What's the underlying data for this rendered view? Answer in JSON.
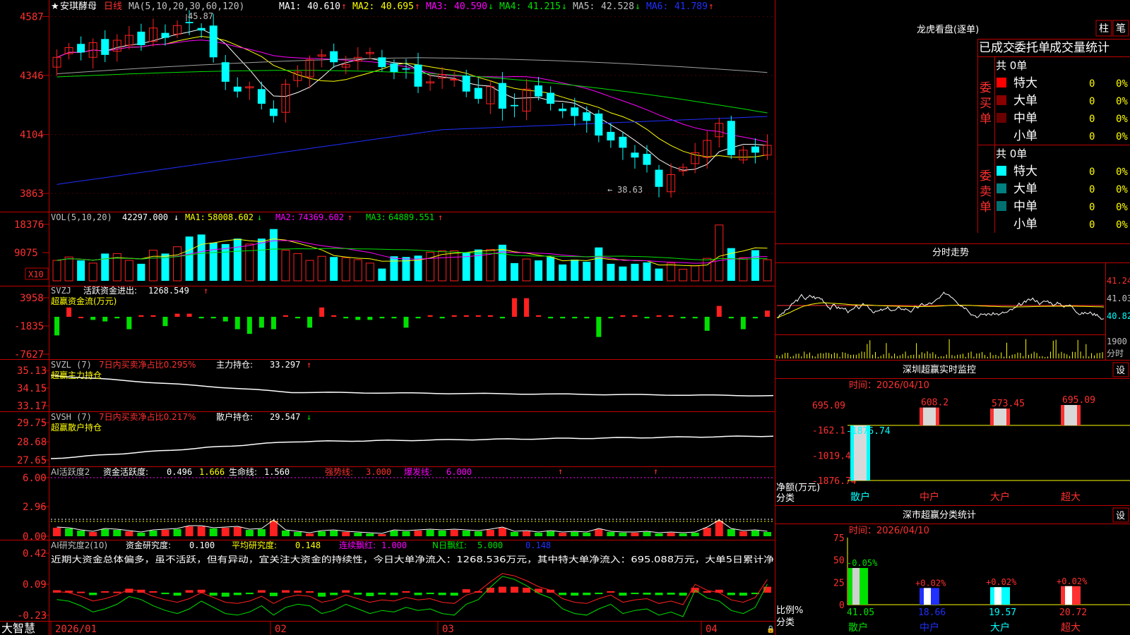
{
  "colors": {
    "up": "#ff2020",
    "down": "#00ffff",
    "grid": "#c00000",
    "text": "#c0c0c0",
    "yellow": "#ffff00",
    "magenta": "#ff00ff",
    "green": "#00e000",
    "white": "#ffffff",
    "blue": "#2030ff",
    "gray": "#a0a0a0"
  },
  "app": {
    "name": "大智慧",
    "lock_icon": "lock-icon"
  },
  "main_panel": {
    "title_star": "★",
    "stock_name": "安琪酵母",
    "period": "日线",
    "ma_label": "MA(5,10,20,30,60,120)",
    "ma_values": [
      {
        "label": "MA1:",
        "value": "40.610",
        "arrow": "↑",
        "color": "#ffffff"
      },
      {
        "label": "MA2:",
        "value": "40.695",
        "arrow": "↑",
        "color": "#ffff00"
      },
      {
        "label": "MA3:",
        "value": "40.590",
        "arrow": "↓",
        "color": "#ff00ff"
      },
      {
        "label": "MA4:",
        "value": "41.215",
        "arrow": "↓",
        "color": "#00e000"
      },
      {
        "label": "MA5:",
        "value": "42.528",
        "arrow": "↓",
        "color": "#c0c0c0"
      },
      {
        "label": "MA6:",
        "value": "41.789",
        "arrow": "↑",
        "color": "#2030ff"
      }
    ],
    "y_ticks": [
      "4587",
      "4346",
      "4104",
      "3863"
    ],
    "high_marker": "45.87",
    "low_marker": "38.63"
  },
  "vol_panel": {
    "title": "VOL(5,10,20)",
    "value": "42297.000",
    "arrow": "↓",
    "ma": [
      {
        "label": "MA1:",
        "value": "58008.602",
        "arrow": "↓",
        "color": "#ffff00"
      },
      {
        "label": "MA2:",
        "value": "74369.602",
        "arrow": "↑",
        "color": "#ff00ff"
      },
      {
        "label": "MA3:",
        "value": "64889.551",
        "arrow": "↑",
        "color": "#00e000"
      }
    ],
    "y_ticks": [
      "18376",
      "9075"
    ],
    "unit_badge": "X10"
  },
  "svzj_panel": {
    "title": "SVZJ",
    "label": "活跃资金进出:",
    "value": "1268.549",
    "arrow": "↑",
    "subtitle": "超赢资金流(万元)",
    "y_ticks": [
      "3958",
      "-1835",
      "-7627"
    ]
  },
  "svzl_panel": {
    "title": "SVZL (7)",
    "ratio_label": "7日内买卖净占比0.295%",
    "label": "主力持仓:",
    "value": "33.297",
    "arrow": "↑",
    "subtitle": "超赢主力持仓",
    "y_ticks": [
      "35.13",
      "34.15",
      "33.17"
    ]
  },
  "svsh_panel": {
    "title": "SVSH (7)",
    "ratio_label": "7日内买卖净占比0.217%",
    "label": "散户持仓:",
    "value": "29.547",
    "arrow": "↓",
    "subtitle": "超赢散户持仓",
    "y_ticks": [
      "29.75",
      "28.68",
      "27.65"
    ]
  },
  "ai_active_panel": {
    "title": "AI活跃度2",
    "label": "资金活跃度:",
    "value": "0.496",
    "v2": "1.666",
    "life_label": "生命线:",
    "life_value": "1.560",
    "strong_label": "强势线:",
    "strong_value": "3.000",
    "burst_label": "爆发线:",
    "burst_value": "6.000",
    "y_ticks": [
      "6.00",
      "2.96",
      "0.00"
    ]
  },
  "ai_research_panel": {
    "title": "AI研究度2(10)",
    "label": "资金研究度:",
    "value": "0.100",
    "avg_label": "平均研究度:",
    "avg_value": "0.148",
    "cont_label": "连续飘红:",
    "cont_value": "1.000",
    "n_label": "N日飘红:",
    "n_value": "5.000",
    "last_value": "0.148",
    "comment": "近期大资金总体偏多，虽不活跃，但有异动，宜关注大资金的持续性，今日大单净流入：1268.536万元，其中特大单净流入：695.088万元，大单5日累计净",
    "y_ticks": [
      "0.42",
      "0.09",
      "-0.23"
    ]
  },
  "x_axis": {
    "labels": [
      "2026/01",
      "02",
      "03",
      "04"
    ]
  },
  "longhu": {
    "title": "龙虎看盘(逐单)",
    "btn_bar": "柱",
    "btn_pen": "笔",
    "tabs": [
      "已成交",
      "委托单",
      "成交量统计"
    ],
    "buy": {
      "label": "委买单",
      "total": "共 0单",
      "rows": [
        {
          "name": "特大",
          "count": "0",
          "pct": "0%",
          "color": "#ff0000"
        },
        {
          "name": "大单",
          "count": "0",
          "pct": "0%",
          "color": "#8b0000"
        },
        {
          "name": "中单",
          "count": "0",
          "pct": "0%",
          "color": "#6b0000"
        },
        {
          "name": "小单",
          "count": "0",
          "pct": "0%",
          "color": "#000000"
        }
      ]
    },
    "sell": {
      "label": "委卖单",
      "total": "共 0单",
      "rows": [
        {
          "name": "特大",
          "count": "0",
          "pct": "0%",
          "color": "#00ffff"
        },
        {
          "name": "大单",
          "count": "0",
          "pct": "0%",
          "color": "#008080"
        },
        {
          "name": "中单",
          "count": "0",
          "pct": "0%",
          "color": "#007070"
        },
        {
          "name": "小单",
          "count": "0",
          "pct": "0%",
          "color": "#000000"
        }
      ]
    }
  },
  "fenshi": {
    "title": "分时走势",
    "y_ticks": [
      "41.24",
      "41.03",
      "40.82"
    ],
    "vol_tick": "1900",
    "vol_unit": "分时"
  },
  "sz_monitor": {
    "title": "深圳超赢实时监控",
    "settings": "设",
    "time": "时间：2026/04/10",
    "ylabel": "净额(万元)",
    "xlabel": "分类",
    "y_ticks": [
      "695.09",
      "-162.1",
      "-1019.46",
      "-1876.74"
    ],
    "chart_data": {
      "type": "bar",
      "categories": [
        "散户",
        "中户",
        "大户",
        "超大"
      ],
      "values": [
        -1876.74,
        608.2,
        573.45,
        695.09
      ],
      "ylim": [
        -1876.74,
        695.09
      ],
      "xlabel": "分类",
      "ylabel": "净额(万元)"
    },
    "labels": [
      "-1876.74",
      "608.2",
      "573.45",
      "695.09"
    ]
  },
  "sz_class": {
    "title": "深市超赢分类统计",
    "settings": "设",
    "time": "时间：2026/04/10",
    "ylabel": "比例%",
    "xlabel": "分类",
    "y_ticks": [
      "75",
      "50",
      "25",
      "0"
    ],
    "chart_data": {
      "type": "bar",
      "categories": [
        "散户",
        "中户",
        "大户",
        "超大"
      ],
      "values": [
        41.05,
        18.66,
        19.57,
        20.72
      ],
      "changes": [
        "-0.05%",
        "+0.02%",
        "+0.02%",
        "+0.02%"
      ],
      "ylim": [
        0,
        75
      ],
      "xlabel": "分类",
      "ylabel": "比例%"
    },
    "value_labels": [
      "41.05",
      "18.66",
      "19.57",
      "20.72"
    ]
  }
}
